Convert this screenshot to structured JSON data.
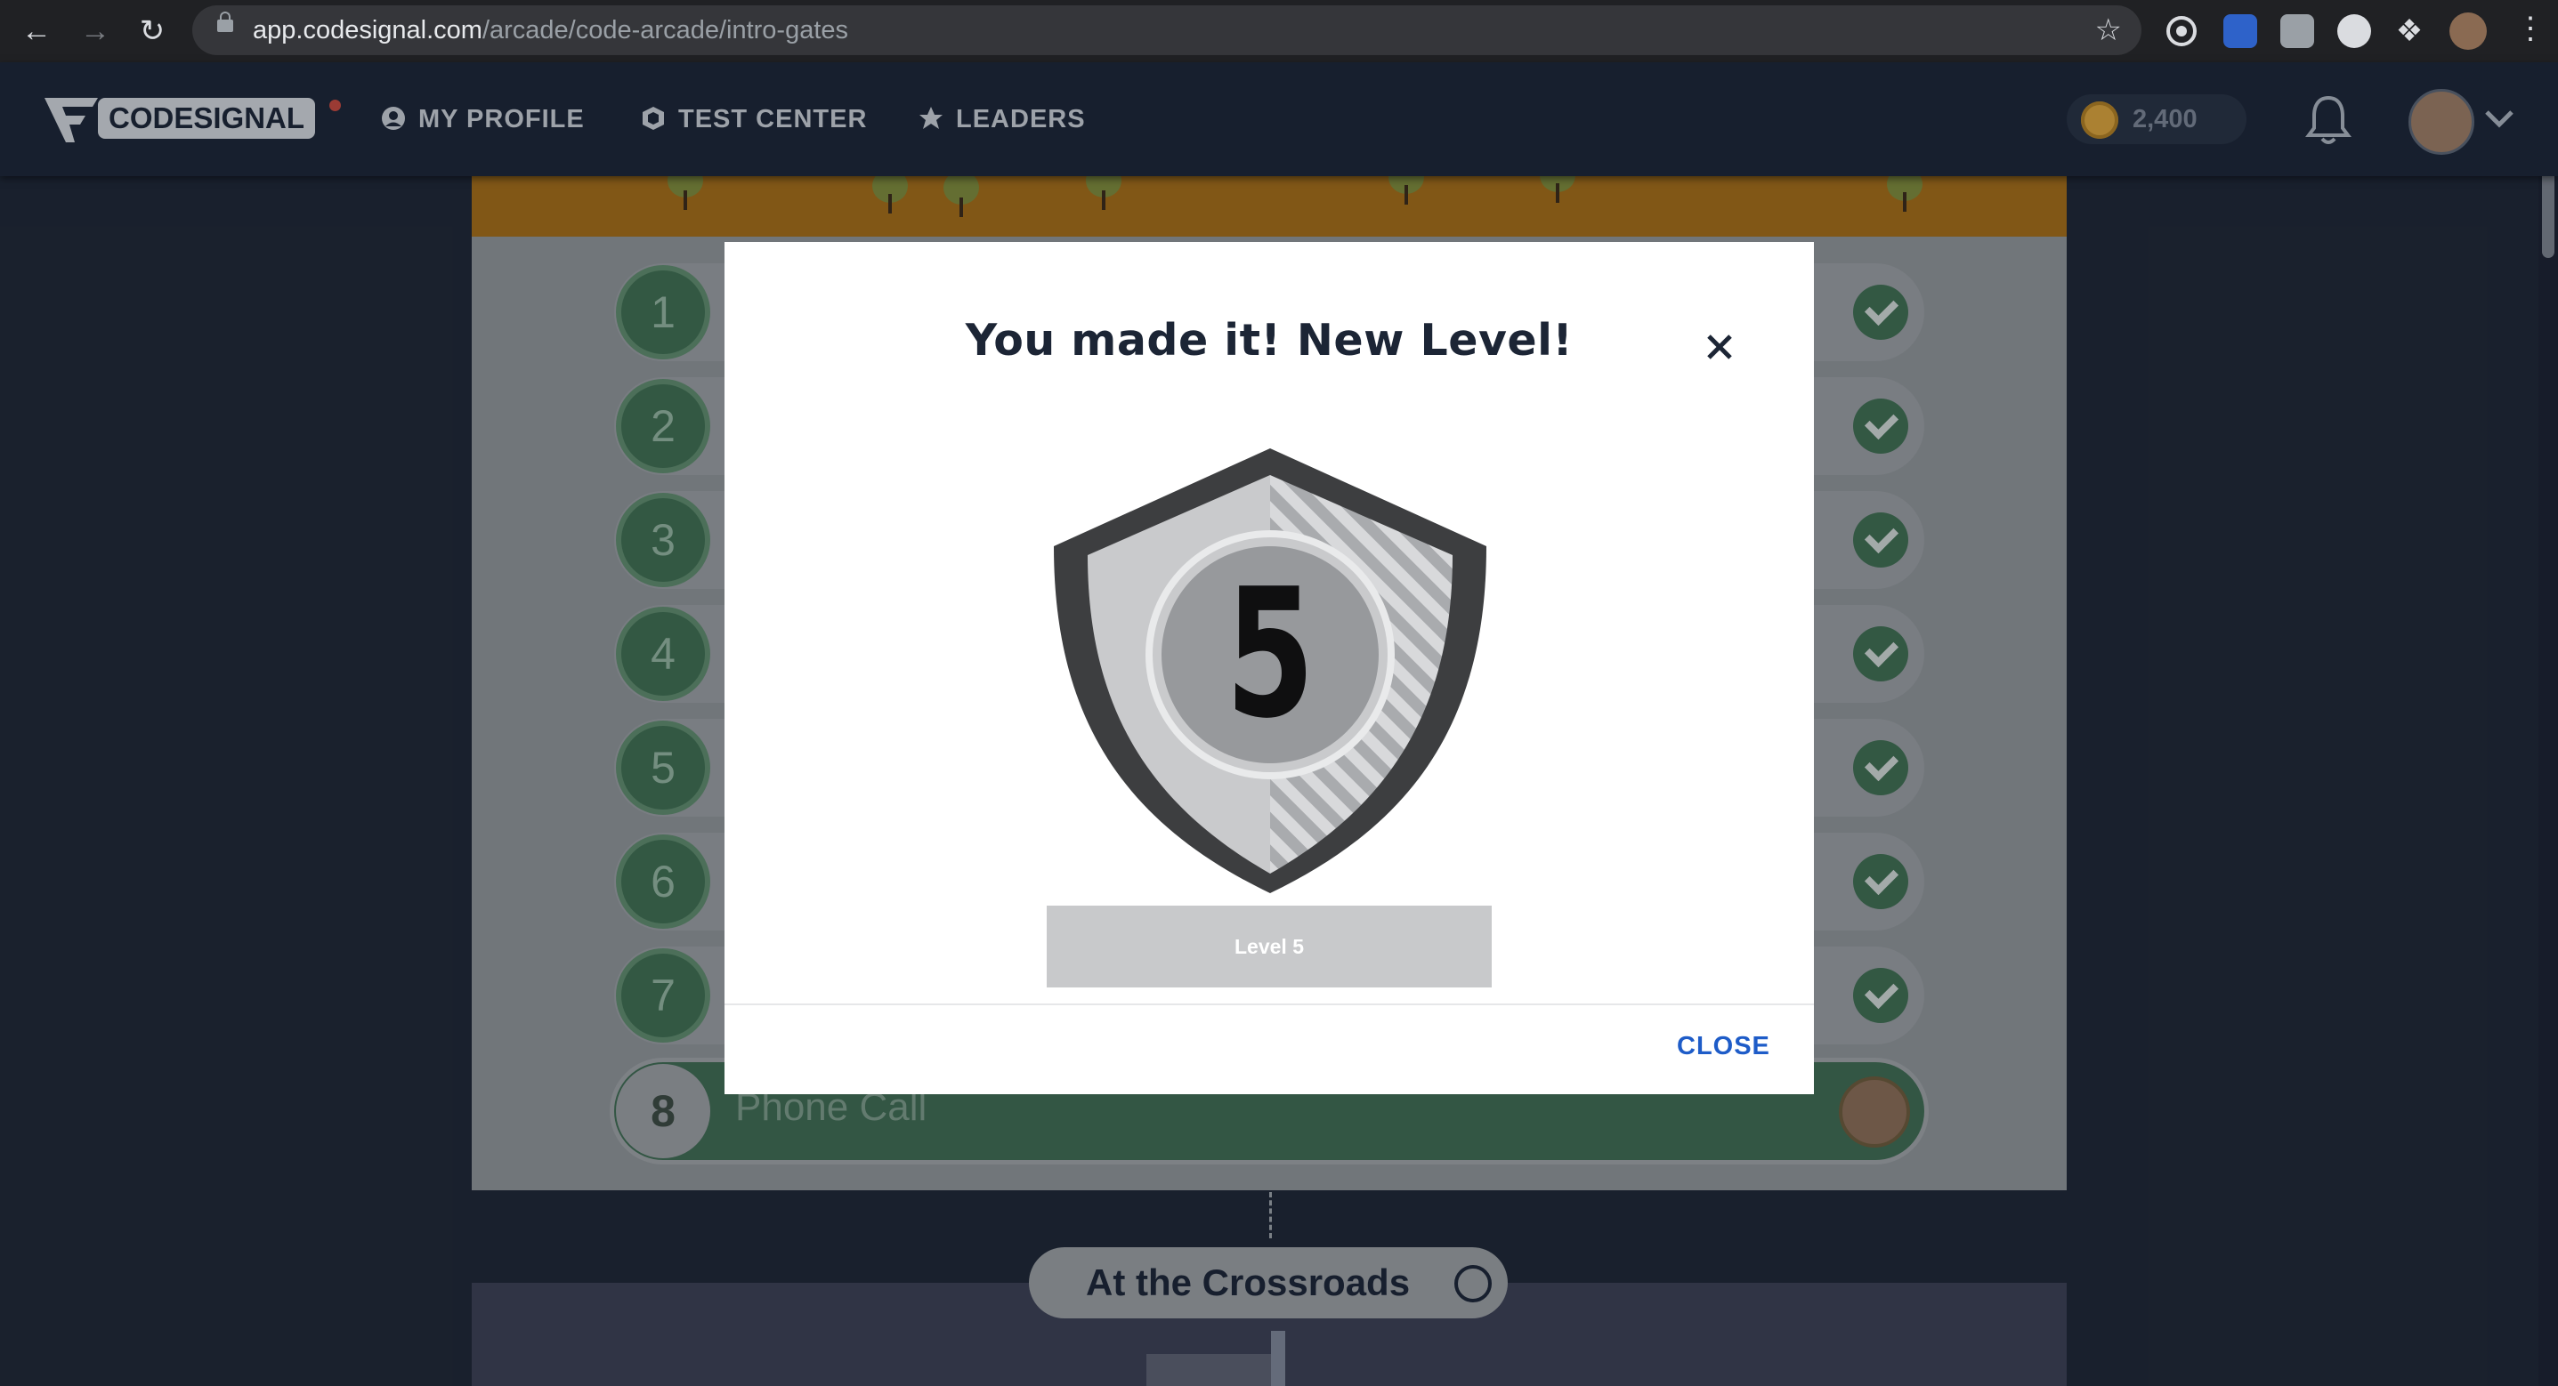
{
  "browser": {
    "url_host": "app.codesignal.com",
    "url_path": "/arcade/code-arcade/intro-gates"
  },
  "header": {
    "logo_text": "CODESIGNAL",
    "nav": [
      {
        "label": "MY PROFILE",
        "icon": "user-circle-icon"
      },
      {
        "label": "TEST CENTER",
        "icon": "shield-hex-icon"
      },
      {
        "label": "LEADERS",
        "icon": "star-icon"
      }
    ],
    "coins": "2,400"
  },
  "levels": [
    {
      "number": "1",
      "title": "",
      "status": "completed"
    },
    {
      "number": "2",
      "title": "",
      "status": "completed"
    },
    {
      "number": "3",
      "title": "",
      "status": "completed"
    },
    {
      "number": "4",
      "title": "",
      "status": "completed"
    },
    {
      "number": "5",
      "title": "",
      "status": "completed"
    },
    {
      "number": "6",
      "title": "",
      "status": "completed"
    },
    {
      "number": "7",
      "title": "",
      "status": "completed"
    },
    {
      "number": "8",
      "title": "Phone Call",
      "status": "current"
    }
  ],
  "next_area": {
    "title": "At the Crossroads"
  },
  "modal": {
    "title": "You made it! New Level!",
    "badge_number": "5",
    "level_label": "Level 5",
    "close_label": "CLOSE"
  },
  "colors": {
    "brand_dark": "#1c2535",
    "close_link": "#1e5cc8",
    "completed_green": "#3f6d50"
  }
}
